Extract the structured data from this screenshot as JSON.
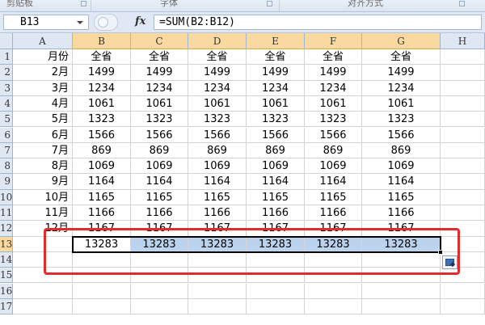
{
  "ribbon": {
    "groups": [
      "剪贴板",
      "字体",
      "对齐方式"
    ]
  },
  "formula_bar": {
    "name_box": "B13",
    "fx_label": "fx",
    "formula": "=SUM(B2:B12)"
  },
  "sheet": {
    "columns": [
      "A",
      "B",
      "C",
      "D",
      "E",
      "F",
      "G",
      "H"
    ],
    "row_numbers": [
      "1",
      "2",
      "3",
      "4",
      "5",
      "6",
      "7",
      "8",
      "9",
      "10",
      "11",
      "12",
      "13",
      "14",
      "15",
      "16",
      "17"
    ],
    "header_row": [
      "月份",
      "全省",
      "全省",
      "全省",
      "全省",
      "全省",
      "全省"
    ],
    "rows": [
      {
        "month": "2月",
        "value": "1499"
      },
      {
        "month": "3月",
        "value": "1234"
      },
      {
        "month": "4月",
        "value": "1061"
      },
      {
        "month": "5月",
        "value": "1323"
      },
      {
        "month": "6月",
        "value": "1566"
      },
      {
        "month": "7月",
        "value": "869"
      },
      {
        "month": "8月",
        "value": "1069"
      },
      {
        "month": "9月",
        "value": "1164"
      },
      {
        "month": "10月",
        "value": "1165"
      },
      {
        "month": "11月",
        "value": "1166"
      },
      {
        "month": "12月",
        "value": "1167"
      }
    ],
    "total_row": [
      "13283",
      "13283",
      "13283",
      "13283",
      "13283",
      "13283"
    ]
  },
  "colors": {
    "selection": "#bcd3ee",
    "annotation": "#e32b2b",
    "header_selected": "#f9d99f"
  },
  "icons": {
    "function": "fx-icon",
    "autofill_options": "auto-fill-options-icon"
  }
}
